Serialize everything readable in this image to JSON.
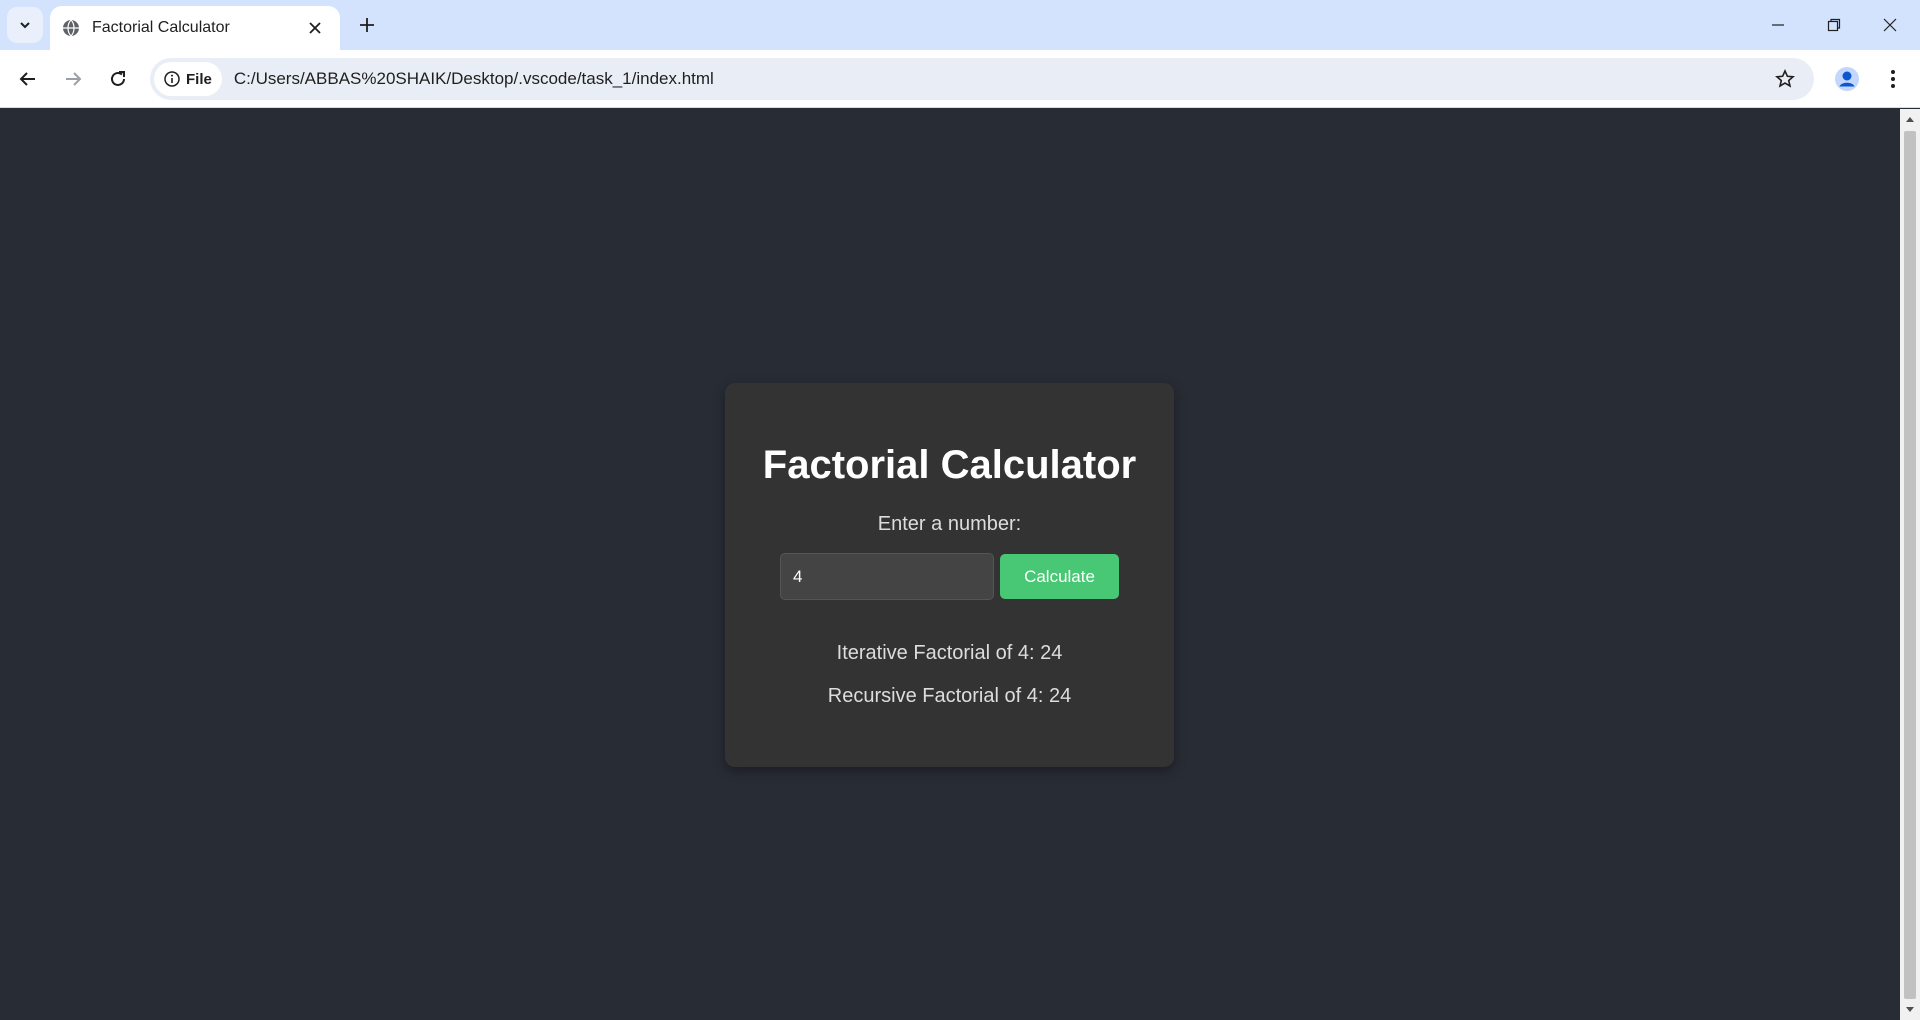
{
  "browser": {
    "tab_title": "Factorial Calculator",
    "site_chip_label": "File",
    "url": "C:/Users/ABBAS%20SHAIK/Desktop/.vscode/task_1/index.html"
  },
  "icons": {
    "tab_search": "chevron-down-icon",
    "favicon": "globe-icon",
    "tab_close": "close-icon",
    "new_tab": "plus-icon",
    "back": "arrow-left-icon",
    "forward": "arrow-right-icon",
    "reload": "reload-icon",
    "site_info": "info-icon",
    "bookmark": "star-icon",
    "profile": "profile-icon",
    "menu": "kebab-menu-icon"
  },
  "app": {
    "title": "Factorial Calculator",
    "input_label": "Enter a number:",
    "input_value": "4",
    "button_label": "Calculate",
    "iterative_result": "Iterative Factorial of 4: 24",
    "recursive_result": "Recursive Factorial of 4: 24"
  },
  "colors": {
    "page_bg": "#282c34",
    "card_bg": "#333333",
    "button_bg": "#48c774",
    "chrome_bg": "#d3e3fd"
  }
}
